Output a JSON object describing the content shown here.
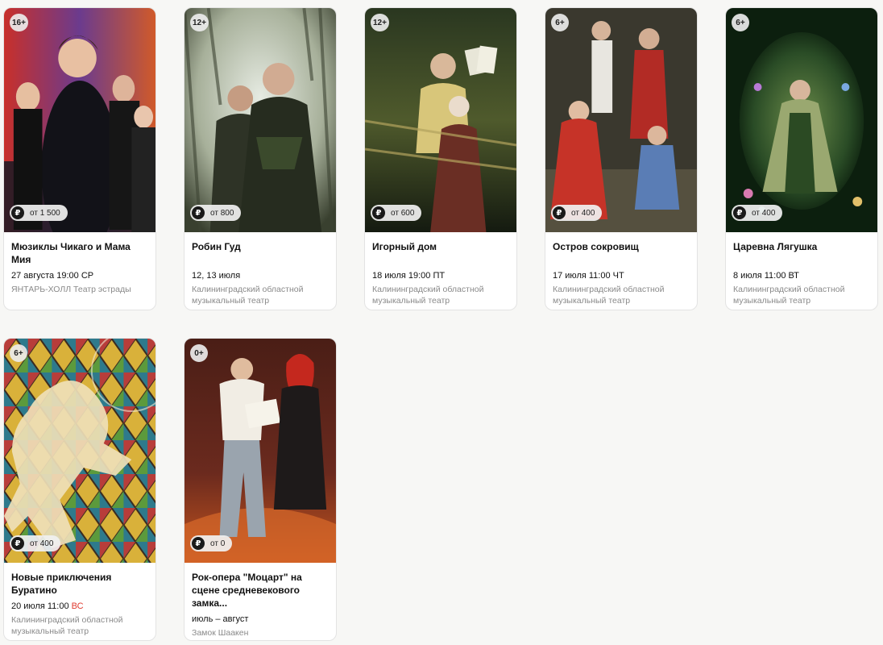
{
  "currency_symbol": "₽",
  "events": [
    {
      "title": "Мюзиклы Чикаго и Мама Мия",
      "age": "16+",
      "price": "от 1 500",
      "date": "27 августа 19:00",
      "weekday": "СР",
      "weekday_highlight": false,
      "venue": "ЯНТАРЬ-ХОЛЛ Театр эстрады",
      "poster_colors": [
        "#d3362f",
        "#5b3a8c",
        "#1a1a24"
      ]
    },
    {
      "title": "Робин Гуд",
      "age": "12+",
      "price": "от 800",
      "date": "12, 13 июля",
      "weekday": "",
      "weekday_highlight": false,
      "venue": "Калининградский областной музыкальный театр",
      "poster_colors": [
        "#c9d1c0",
        "#4c5a3f",
        "#1e2419"
      ]
    },
    {
      "title": "Игорный дом",
      "age": "12+",
      "price": "от 600",
      "date": "18 июля 19:00",
      "weekday": "ПТ",
      "weekday_highlight": false,
      "venue": "Калининградский областной музыкальный театр",
      "poster_colors": [
        "#3c4a2a",
        "#b9a766",
        "#141a10"
      ]
    },
    {
      "title": "Остров сокровищ",
      "age": "6+",
      "price": "от 400",
      "date": "17 июля 11:00",
      "weekday": "ЧТ",
      "weekday_highlight": false,
      "venue": "Калининградский областной музыкальный театр",
      "poster_colors": [
        "#3d3a30",
        "#b22b25",
        "#5a7db5"
      ]
    },
    {
      "title": "Царевна Лягушка",
      "age": "6+",
      "price": "от 400",
      "date": "8 июля 11:00",
      "weekday": "ВТ",
      "weekday_highlight": false,
      "venue": "Калининградский областной музыкальный театр",
      "poster_colors": [
        "#0f2a12",
        "#6c8c4a",
        "#2a4c26"
      ]
    },
    {
      "title": "Новые приключения Буратино",
      "age": "6+",
      "price": "от 400",
      "date": "20 июля 11:00",
      "weekday": "ВС",
      "weekday_highlight": true,
      "venue": "Калининградский областной музыкальный театр",
      "poster_colors": [
        "#d9b13a",
        "#2e7a8c",
        "#b83d3a"
      ]
    },
    {
      "title": "Рок-опера \"Моцарт\" на сцене средневекового замка...",
      "age": "0+",
      "price": "от 0",
      "date": "июль – август",
      "weekday": "",
      "weekday_highlight": false,
      "venue": "Замок Шаакен",
      "poster_colors": [
        "#6b2a1e",
        "#c4541e",
        "#2a1410"
      ]
    }
  ]
}
